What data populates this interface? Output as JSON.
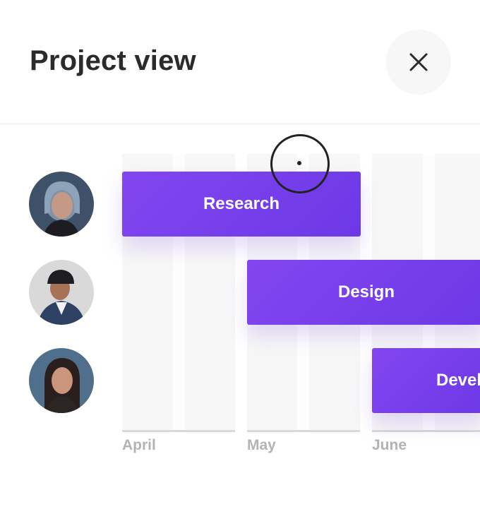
{
  "header": {
    "title": "Project view",
    "close_icon": "close-icon"
  },
  "timeline": {
    "months": [
      "April",
      "May",
      "June"
    ],
    "tasks": [
      {
        "label": "Research",
        "start_month": "April",
        "end_month": "May",
        "assignee_row": 1
      },
      {
        "label": "Design",
        "start_month": "May",
        "end_month": "June",
        "assignee_row": 2
      },
      {
        "label": "Development",
        "start_month": "June",
        "end_month": "June",
        "assignee_row": 3,
        "visible_text": "Devel"
      }
    ],
    "avatars": [
      "avatar-1",
      "avatar-2",
      "avatar-3"
    ]
  },
  "colors": {
    "accent": "#7b3ff0",
    "title": "#2b2b2b",
    "month_label": "#b3b3b3",
    "grid": "#f7f7f7"
  }
}
